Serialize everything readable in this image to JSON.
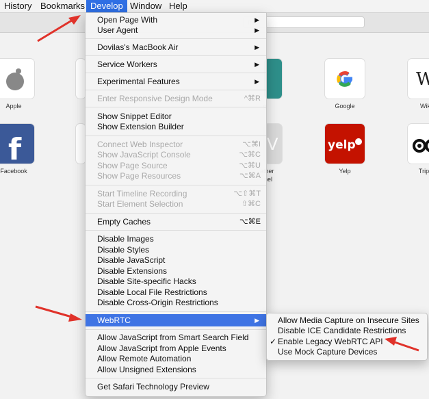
{
  "menubar": {
    "items": [
      "History",
      "Bookmarks",
      "Develop",
      "Window",
      "Help"
    ],
    "active": "Develop"
  },
  "search": {
    "placeholder": "me"
  },
  "favorites": [
    {
      "label": "Apple",
      "icon": "apple-icon"
    },
    {
      "label": "",
      "icon": "partial-tile"
    },
    {
      "label": "g",
      "icon": "teal-tile"
    },
    {
      "label": "Google",
      "icon": "google-icon"
    },
    {
      "label": "Wikip",
      "icon": "wikipedia-icon"
    },
    {
      "label": "Facebook",
      "icon": "facebook-icon"
    },
    {
      "label": "",
      "icon": "partial-tile"
    },
    {
      "label": "ather",
      "icon": "weather-icon"
    },
    {
      "label": "nel",
      "icon": "weather-icon"
    },
    {
      "label": "Yelp",
      "icon": "yelp-icon"
    },
    {
      "label": "TripAd",
      "icon": "tripadvisor-icon"
    }
  ],
  "develop_menu": {
    "open_page_with": "Open Page With",
    "user_agent": "User Agent",
    "device": "Dovilas's MacBook Air",
    "service_workers": "Service Workers",
    "experimental": "Experimental Features",
    "responsive": {
      "label": "Enter Responsive Design Mode",
      "shortcut": "^⌘R"
    },
    "snippet_editor": "Show Snippet Editor",
    "extension_builder": "Show Extension Builder",
    "web_inspector": {
      "label": "Connect Web Inspector",
      "shortcut": "⌥⌘I"
    },
    "js_console": {
      "label": "Show JavaScript Console",
      "shortcut": "⌥⌘C"
    },
    "page_source": {
      "label": "Show Page Source",
      "shortcut": "⌥⌘U"
    },
    "page_resources": {
      "label": "Show Page Resources",
      "shortcut": "⌥⌘A"
    },
    "timeline": {
      "label": "Start Timeline Recording",
      "shortcut": "⌥⇧⌘T"
    },
    "element_selection": {
      "label": "Start Element Selection",
      "shortcut": "⇧⌘C"
    },
    "empty_caches": {
      "label": "Empty Caches",
      "shortcut": "⌥⌘E"
    },
    "disable_images": "Disable Images",
    "disable_styles": "Disable Styles",
    "disable_js": "Disable JavaScript",
    "disable_extensions": "Disable Extensions",
    "disable_hacks": "Disable Site-specific Hacks",
    "disable_local": "Disable Local File Restrictions",
    "disable_cors": "Disable Cross-Origin Restrictions",
    "webrtc": "WebRTC",
    "allow_js_smart_search": "Allow JavaScript from Smart Search Field",
    "allow_js_apple_events": "Allow JavaScript from Apple Events",
    "allow_remote": "Allow Remote Automation",
    "allow_unsigned": "Allow Unsigned Extensions",
    "tech_preview": "Get Safari Technology Preview"
  },
  "webrtc_submenu": {
    "media_capture": "Allow Media Capture on Insecure Sites",
    "ice": "Disable ICE Candidate Restrictions",
    "legacy": "Enable Legacy WebRTC API",
    "legacy_checked": "✓",
    "mock": "Use Mock Capture Devices"
  },
  "colors": {
    "highlight": "#3f74e4",
    "annotation": "#e0322a"
  }
}
